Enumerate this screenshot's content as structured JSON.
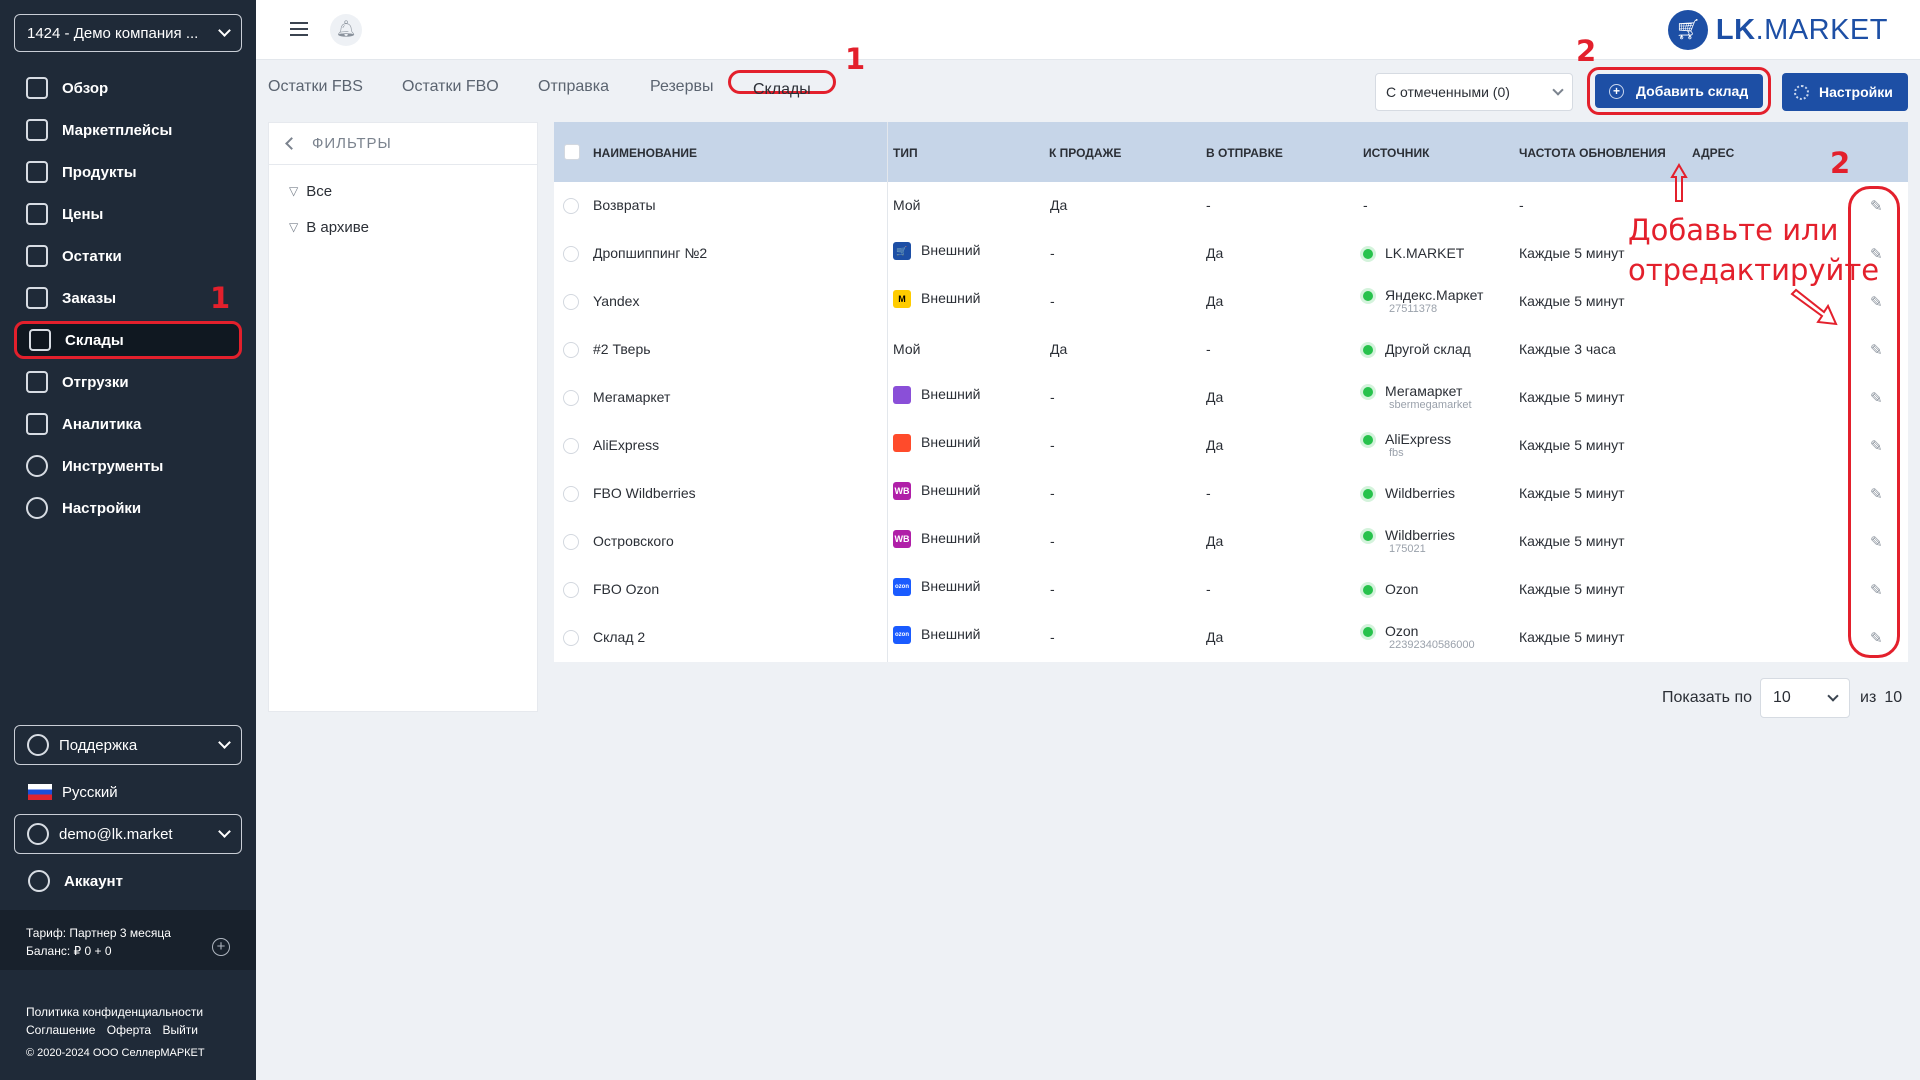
{
  "sidebar": {
    "company": "1424 - Демо компания ...",
    "nav": [
      {
        "label": "Обзор",
        "icon": "overview-icon"
      },
      {
        "label": "Маркетплейсы",
        "icon": "marketplaces-icon"
      },
      {
        "label": "Продукты",
        "icon": "products-icon"
      },
      {
        "label": "Цены",
        "icon": "prices-icon"
      },
      {
        "label": "Остатки",
        "icon": "stock-icon"
      },
      {
        "label": "Заказы",
        "icon": "orders-icon"
      },
      {
        "label": "Склады",
        "icon": "warehouse-icon"
      },
      {
        "label": "Отгрузки",
        "icon": "shipments-icon"
      },
      {
        "label": "Аналитика",
        "icon": "analytics-icon"
      },
      {
        "label": "Инструменты",
        "icon": "tools-icon"
      },
      {
        "label": "Настройки",
        "icon": "settings-icon"
      }
    ],
    "support": "Поддержка",
    "language": "Русский",
    "user_email": "demo@lk.market",
    "account": "Аккаунт",
    "tariff": "Тариф: Партнер 3 месяца",
    "balance": "Баланс: ₽ 0 + 0",
    "footer": {
      "privacy": "Политика конфиденциальности",
      "agreement": "Соглашение",
      "offer": "Оферта",
      "logout": "Выйти",
      "copyright": "© 2020-2024 ООО СеллерМАРКЕТ"
    }
  },
  "header": {
    "logo_lk": "LK",
    "logo_market": ".MARKET"
  },
  "tabs": [
    "Остатки FBS",
    "Остатки FBO",
    "Отправка",
    "Резервы",
    "Склады"
  ],
  "toolbar": {
    "bulk_select": "С отмеченными (0)",
    "add_warehouse": "Добавить склад",
    "settings": "Настройки"
  },
  "filters": {
    "title": "ФИЛЬТРЫ",
    "items": [
      "Все",
      "В архиве"
    ]
  },
  "table": {
    "columns": [
      "НАИМЕНОВАНИЕ",
      "ТИП",
      "К ПРОДАЖЕ",
      "В ОТПРАВКЕ",
      "ИСТОЧНИК",
      "ЧАСТОТА ОБНОВЛЕНИЯ",
      "АДРЕС"
    ],
    "rows": [
      {
        "name": "Возвраты",
        "type": "Мой",
        "type_icon": "",
        "for_sale": "Да",
        "in_shipping": "-",
        "source": "-",
        "source_sub": "",
        "source_dot": false,
        "frequency": "-"
      },
      {
        "name": "Дропшиппинг №2",
        "type": "Внешний",
        "type_icon": "lkmarket",
        "for_sale": "-",
        "in_shipping": "Да",
        "source": "LK.MARKET",
        "source_sub": "",
        "source_dot": true,
        "frequency": "Каждые 5 минут"
      },
      {
        "name": "Yandex",
        "type": "Внешний",
        "type_icon": "yandex",
        "for_sale": "-",
        "in_shipping": "Да",
        "source": "Яндекс.Маркет",
        "source_sub": "27511378",
        "source_dot": true,
        "frequency": "Каждые 5 минут"
      },
      {
        "name": "#2 Тверь",
        "type": "Мой",
        "type_icon": "",
        "for_sale": "Да",
        "in_shipping": "-",
        "source": "Другой склад",
        "source_sub": "",
        "source_dot": true,
        "frequency": "Каждые 3 часа"
      },
      {
        "name": "Мегамаркет",
        "type": "Внешний",
        "type_icon": "megamarket",
        "for_sale": "-",
        "in_shipping": "Да",
        "source": "Мегамаркет",
        "source_sub": "sbermegamarket",
        "source_dot": true,
        "frequency": "Каждые 5 минут"
      },
      {
        "name": "AliExpress",
        "type": "Внешний",
        "type_icon": "aliexpress",
        "for_sale": "-",
        "in_shipping": "Да",
        "source": "AliExpress",
        "source_sub": "fbs",
        "source_dot": true,
        "frequency": "Каждые 5 минут"
      },
      {
        "name": "FBO Wildberries",
        "type": "Внешний",
        "type_icon": "wildberries",
        "for_sale": "-",
        "in_shipping": "-",
        "source": "Wildberries",
        "source_sub": "",
        "source_dot": true,
        "frequency": "Каждые 5 минут"
      },
      {
        "name": "Островского",
        "type": "Внешний",
        "type_icon": "wildberries",
        "for_sale": "-",
        "in_shipping": "Да",
        "source": "Wildberries",
        "source_sub": "175021",
        "source_dot": true,
        "frequency": "Каждые 5 минут"
      },
      {
        "name": "FBO Ozon",
        "type": "Внешний",
        "type_icon": "ozon",
        "for_sale": "-",
        "in_shipping": "-",
        "source": "Ozon",
        "source_sub": "",
        "source_dot": true,
        "frequency": "Каждые 5 минут"
      },
      {
        "name": "Склад 2",
        "type": "Внешний",
        "type_icon": "ozon",
        "for_sale": "-",
        "in_shipping": "Да",
        "source": "Ozon",
        "source_sub": "22392340586000",
        "source_dot": true,
        "frequency": "Каждые 5 минут"
      }
    ]
  },
  "pagination": {
    "show_label": "Показать по",
    "per_page": "10",
    "of_label": "из",
    "total": "10"
  },
  "annotations": {
    "num1": "1",
    "num2": "2",
    "hint_line1": "Добавьте или",
    "hint_line2": "отредактируйте"
  },
  "colors": {
    "accent": "#1d4fa5",
    "sidebar_bg": "#1f2a38",
    "annotation": "#e3202c",
    "status_green": "#27c24c"
  }
}
